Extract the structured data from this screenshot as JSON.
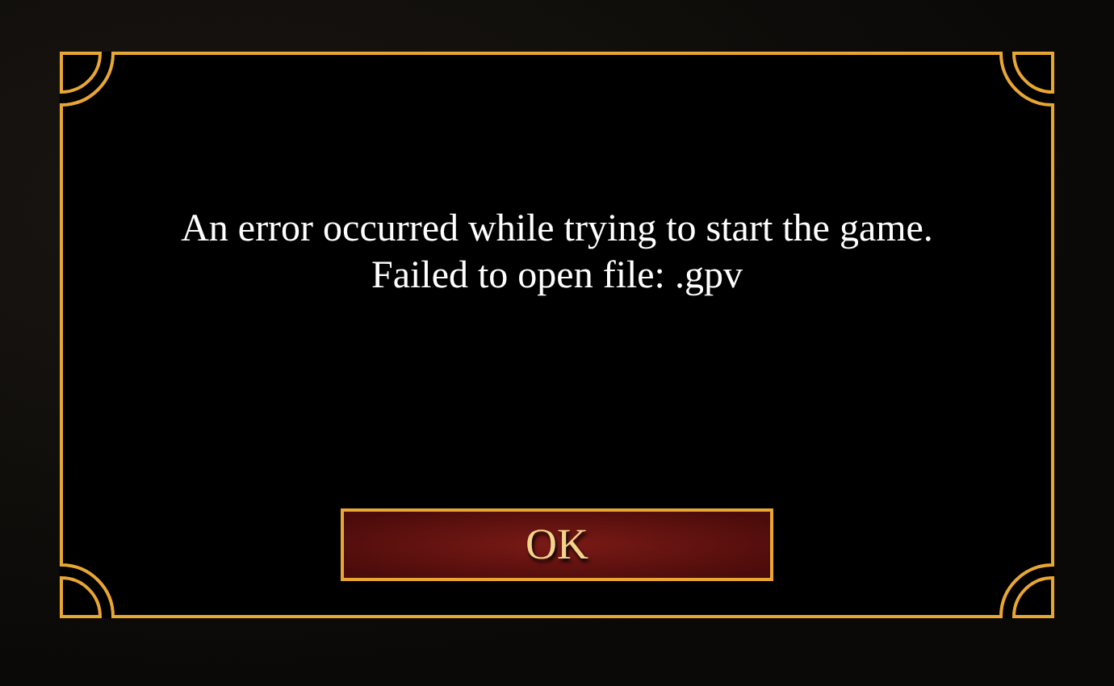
{
  "dialog": {
    "message": [
      "An error occurred while trying to start the game.",
      "Failed to open file: .gpv"
    ],
    "buttons": [
      {
        "label": "OK"
      }
    ]
  }
}
